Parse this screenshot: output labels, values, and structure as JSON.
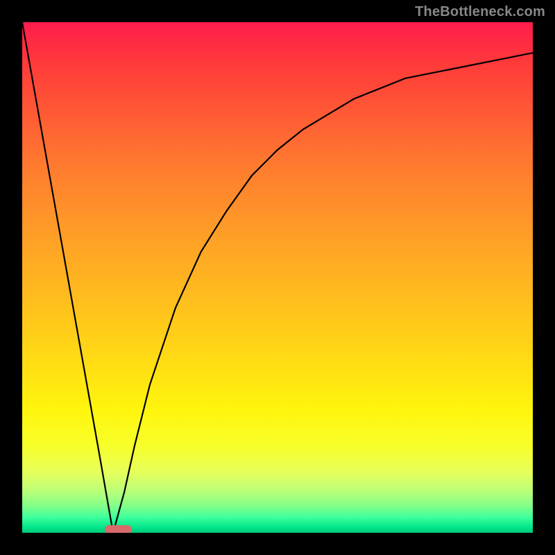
{
  "watermark": "TheBottleneck.com",
  "colors": {
    "frame": "#000000",
    "curve": "#000000",
    "marker": "#d96a6a",
    "watermark": "#878787",
    "gradient_stops": [
      {
        "pct": 0,
        "hex": "#ff1c4d"
      },
      {
        "pct": 8,
        "hex": "#ff3a3a"
      },
      {
        "pct": 18,
        "hex": "#ff5a35"
      },
      {
        "pct": 28,
        "hex": "#ff7a2f"
      },
      {
        "pct": 40,
        "hex": "#ff9a28"
      },
      {
        "pct": 52,
        "hex": "#ffb81f"
      },
      {
        "pct": 64,
        "hex": "#ffd616"
      },
      {
        "pct": 76,
        "hex": "#fff50d"
      },
      {
        "pct": 83,
        "hex": "#f7ff2a"
      },
      {
        "pct": 88,
        "hex": "#e7ff5a"
      },
      {
        "pct": 92,
        "hex": "#b8ff7a"
      },
      {
        "pct": 95,
        "hex": "#7cff8a"
      },
      {
        "pct": 97,
        "hex": "#3cff9c"
      },
      {
        "pct": 99,
        "hex": "#00e68a"
      },
      {
        "pct": 100,
        "hex": "#00c878"
      }
    ]
  },
  "chart_data": {
    "type": "line",
    "x": [
      0.0,
      0.05,
      0.1,
      0.15,
      0.178,
      0.2,
      0.22,
      0.25,
      0.3,
      0.35,
      0.4,
      0.45,
      0.5,
      0.55,
      0.6,
      0.65,
      0.7,
      0.75,
      0.8,
      0.85,
      0.9,
      0.95,
      1.0
    ],
    "y": [
      1.0,
      0.72,
      0.44,
      0.16,
      0.0,
      0.08,
      0.17,
      0.29,
      0.44,
      0.55,
      0.63,
      0.7,
      0.75,
      0.79,
      0.82,
      0.85,
      0.87,
      0.89,
      0.9,
      0.91,
      0.92,
      0.93,
      0.94
    ],
    "xlim": [
      0,
      1
    ],
    "ylim": [
      0,
      1
    ],
    "minimum_x": 0.178,
    "marker_x_range": [
      0.162,
      0.215
    ],
    "title": "",
    "xlabel": "",
    "ylabel": ""
  }
}
